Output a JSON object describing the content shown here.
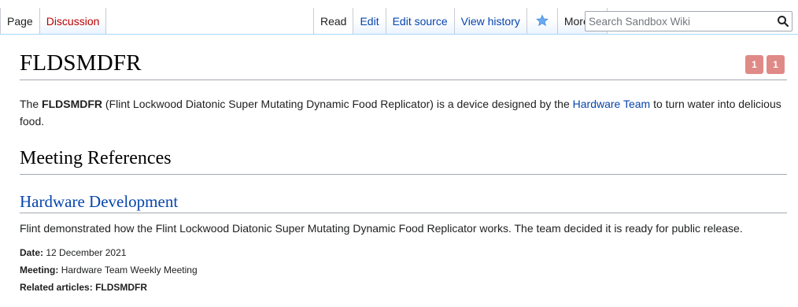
{
  "tabs_left": [
    {
      "label": "Page",
      "selected": true
    },
    {
      "label": "Discussion",
      "redlink": true
    }
  ],
  "tabs_right": {
    "read": "Read",
    "edit": "Edit",
    "edit_source": "Edit source",
    "view_history": "View history",
    "more": "More",
    "star_icon": "star-icon"
  },
  "search": {
    "placeholder": "Search Sandbox Wiki",
    "value": ""
  },
  "page": {
    "title": "FLDSMDFR",
    "badges": [
      "1",
      "1"
    ],
    "badge_color": "#e08a87",
    "intro": {
      "pre": "The ",
      "bold": "FLDSMDFR",
      "mid": " (Flint Lockwood Diatonic Super Mutating Dynamic Food Replicator) is a device designed by the ",
      "link": "Hardware Team",
      "post": " to turn water into delicious food."
    },
    "section_heading": "Meeting References",
    "subsection": {
      "heading": "Hardware Development",
      "description": "Flint demonstrated how the Flint Lockwood Diatonic Super Mutating Dynamic Food Replicator works. The team decided it is ready for public release.",
      "date_label": "Date:",
      "date_value": "12 December 2021",
      "meeting_label": "Meeting:",
      "meeting_value": "Hardware Team Weekly Meeting",
      "related_label": "Related articles:",
      "related_value": "FLDSMDFR"
    }
  },
  "colors": {
    "link": "#0645ad",
    "redlink": "#ba0000",
    "tab_border": "#a7d7f9"
  }
}
